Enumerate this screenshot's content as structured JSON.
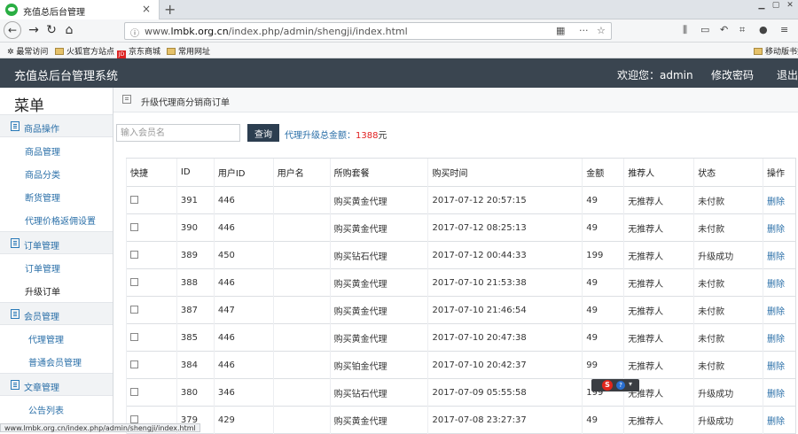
{
  "browser": {
    "tab_title": "充值总后台管理",
    "tab_close": "×",
    "tab_new": "+",
    "url_prefix": "www.",
    "url_domain": "lmbk.org.cn",
    "url_path": "/index.php/admin/shengji/index.html",
    "bookmarks": [
      "最常访问",
      "火狐官方站点",
      "京东商城",
      "常用网址",
      "移动版书签"
    ],
    "status_url": "www.lmbk.org.cn/index.php/admin/shengji/index.html"
  },
  "app": {
    "title": "充值总后台管理系统",
    "welcome": "欢迎您：admin",
    "change_password": "修改密码",
    "logout": "退出"
  },
  "sidebar": {
    "title": "菜单",
    "groups": [
      {
        "label": "商品操作",
        "items": [
          "商品管理",
          "商品分类",
          "断货管理",
          "代理价格返佣设置"
        ]
      },
      {
        "label": "订单管理",
        "items": [
          "订单管理",
          "升级订单"
        ]
      },
      {
        "label": "会员管理",
        "items": [
          "代理管理",
          "普通会员管理"
        ]
      },
      {
        "label": "文章管理",
        "items": [
          "公告列表"
        ]
      }
    ],
    "active_item": "升级订单"
  },
  "breadcrumb": "升级代理商分销商订单",
  "search": {
    "placeholder": "输入会员名",
    "button": "查询",
    "total_label": "代理升级总金额：",
    "total_amount": "1388",
    "total_unit": "元"
  },
  "table": {
    "headers": [
      "快捷",
      "ID",
      "用户ID",
      "用户名",
      "所购套餐",
      "购买时间",
      "金额",
      "推荐人",
      "状态",
      "操作"
    ],
    "rows": [
      {
        "id": "391",
        "uid": "446",
        "username": "",
        "package": "购买黄金代理",
        "time": "2017-07-12 20:57:15",
        "amount": "49",
        "referrer": "无推荐人",
        "status": "未付款",
        "action": "删除"
      },
      {
        "id": "390",
        "uid": "446",
        "username": "",
        "package": "购买黄金代理",
        "time": "2017-07-12 08:25:13",
        "amount": "49",
        "referrer": "无推荐人",
        "status": "未付款",
        "action": "删除"
      },
      {
        "id": "389",
        "uid": "450",
        "username": "",
        "package": "购买钻石代理",
        "time": "2017-07-12 00:44:33",
        "amount": "199",
        "referrer": "无推荐人",
        "status": "升级成功",
        "action": "删除"
      },
      {
        "id": "388",
        "uid": "446",
        "username": "",
        "package": "购买黄金代理",
        "time": "2017-07-10 21:53:38",
        "amount": "49",
        "referrer": "无推荐人",
        "status": "未付款",
        "action": "删除"
      },
      {
        "id": "387",
        "uid": "447",
        "username": "",
        "package": "购买黄金代理",
        "time": "2017-07-10 21:46:54",
        "amount": "49",
        "referrer": "无推荐人",
        "status": "未付款",
        "action": "删除"
      },
      {
        "id": "385",
        "uid": "446",
        "username": "",
        "package": "购买黄金代理",
        "time": "2017-07-10 20:47:38",
        "amount": "49",
        "referrer": "无推荐人",
        "status": "未付款",
        "action": "删除"
      },
      {
        "id": "384",
        "uid": "446",
        "username": "",
        "package": "购买铂金代理",
        "time": "2017-07-10 20:42:37",
        "amount": "99",
        "referrer": "无推荐人",
        "status": "未付款",
        "action": "删除"
      },
      {
        "id": "380",
        "uid": "346",
        "username": "",
        "package": "购买钻石代理",
        "time": "2017-07-09 05:55:58",
        "amount": "199",
        "referrer": "无推荐人",
        "status": "升级成功",
        "action": "删除"
      },
      {
        "id": "379",
        "uid": "429",
        "username": "",
        "package": "购买黄金代理",
        "time": "2017-07-08 23:27:37",
        "amount": "49",
        "referrer": "无推荐人",
        "status": "升级成功",
        "action": "删除"
      }
    ]
  },
  "ime": {
    "brand": "S",
    "help": "?",
    "menu": "▾"
  },
  "colors": {
    "header_bg": "#3a4550",
    "link": "#2a6fa8",
    "amount": "#e02020",
    "button_bg": "#2c3e50"
  }
}
